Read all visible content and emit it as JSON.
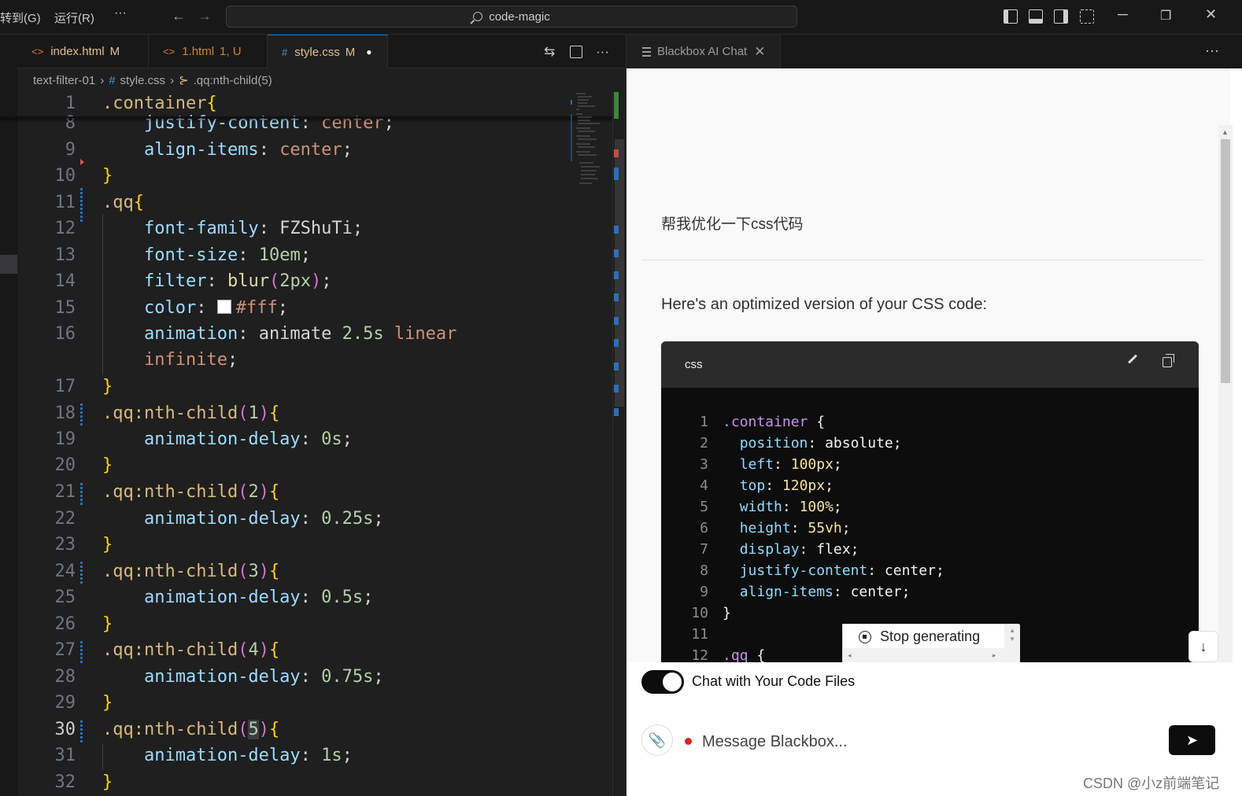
{
  "menubar": {
    "goto": "转到(G)",
    "run": "运行(R)",
    "more": "···"
  },
  "search": {
    "text": "code-magic"
  },
  "editor_tabs": [
    {
      "icon": "<>",
      "name": "index.html",
      "status": "M"
    },
    {
      "icon": "<>",
      "name": "1.html",
      "status": "1, U"
    },
    {
      "icon": "#",
      "name": "style.css",
      "status": "M",
      "dirty": "●"
    }
  ],
  "breadcrumb": {
    "folder": "text-filter-01",
    "file": "style.css",
    "symbol": ".qq:nth-child(5)"
  },
  "panel": {
    "tab_title": "Blackbox AI Chat",
    "close": "✕",
    "more": "···"
  },
  "chat": {
    "user_message": "帮我优化一下css代码",
    "ai_message": "Here's an optimized version of your CSS code:",
    "code_lang": "css",
    "stop_label": "Stop generating",
    "toggle_label": "Chat with Your Code Files",
    "toggle_on": true,
    "input_placeholder": "Message Blackbox..."
  },
  "watermark": "CSDN @小z前端笔记",
  "colors": {
    "accent": "#0078d4",
    "modified": "#e2c08d",
    "untracked": "#73c991",
    "chat_dark": "#0d0d0d"
  }
}
